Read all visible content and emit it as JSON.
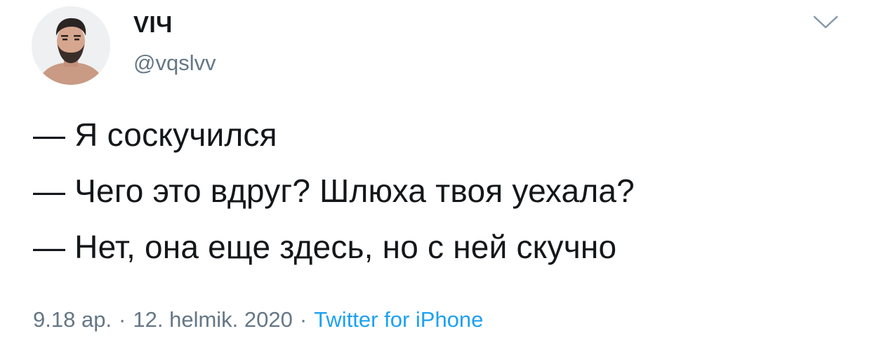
{
  "author": {
    "display_name": "VIЧ",
    "handle": "@vqslvv"
  },
  "tweet": {
    "lines": [
      "— Я соскучился",
      "— Чего это вдруг? Шлюха твоя уехала?",
      "— Нет, она еще здесь, но с ней скучно"
    ]
  },
  "meta": {
    "time": "9.18 ap.",
    "separator": "·",
    "date": "12. helmik. 2020",
    "source": "Twitter for iPhone"
  },
  "colors": {
    "text": "#14171a",
    "secondary": "#657786",
    "link": "#1da1f2"
  },
  "icons": {
    "menu": "chevron-down-icon"
  }
}
